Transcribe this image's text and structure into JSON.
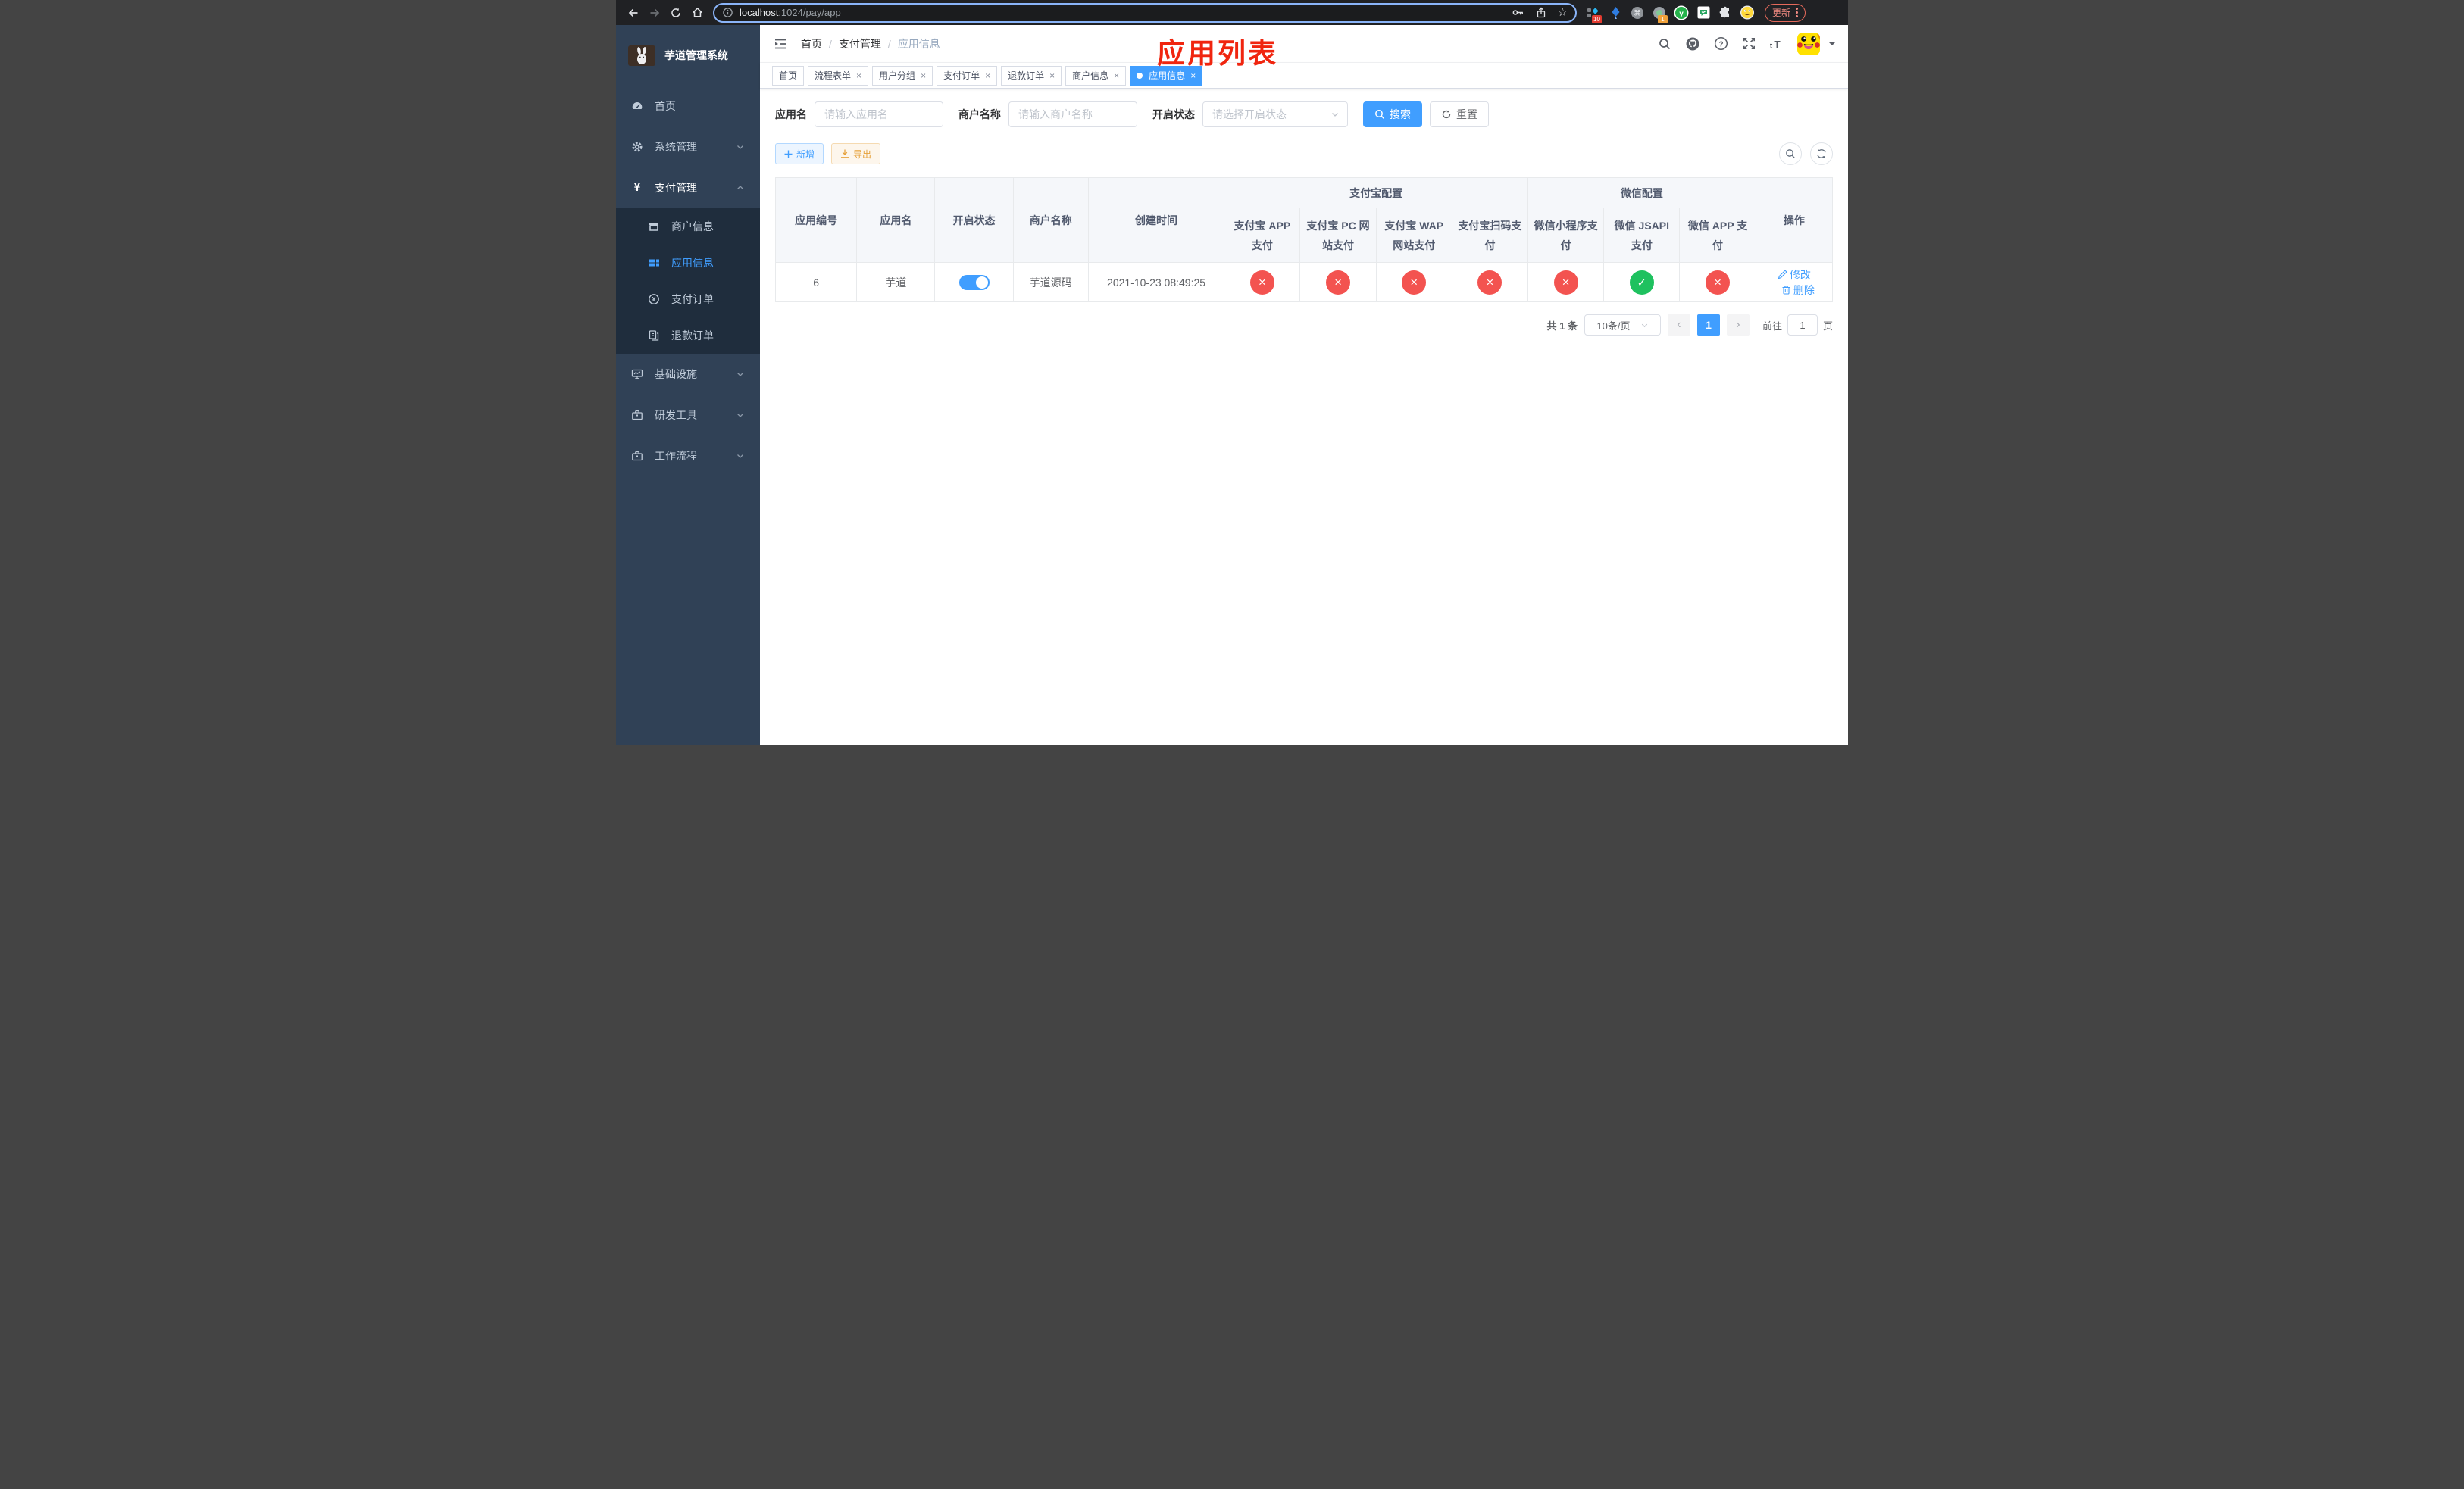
{
  "browser": {
    "url_host": "localhost",
    "url_path": ":1024/pay/app",
    "update_label": "更新",
    "ext_badge_blue_diamond": "10",
    "ext_badge_record": "1"
  },
  "annotation": {
    "text": "应用列表",
    "color": "#f0250f"
  },
  "colors": {
    "primary": "#409eff",
    "danger": "#f35350",
    "success": "#1ec15f",
    "warning": "#e6a23c",
    "sidebar_bg": "#304156",
    "submenu_bg": "#1f2d3d"
  },
  "sidebar": {
    "title": "芋道管理系统",
    "menu_top": [
      {
        "label": "首页",
        "icon": "dashboard-icon"
      },
      {
        "label": "系统管理",
        "icon": "gear-icon"
      },
      {
        "label": "支付管理",
        "icon": "yen-icon"
      }
    ],
    "pay_children": [
      {
        "label": "商户信息",
        "icon": "shop-icon"
      },
      {
        "label": "应用信息",
        "icon": "grid-icon"
      },
      {
        "label": "支付订单",
        "icon": "pay-order-icon"
      },
      {
        "label": "退款订单",
        "icon": "refund-icon"
      }
    ],
    "menu_bottom": [
      {
        "label": "基础设施",
        "icon": "monitor-icon"
      },
      {
        "label": "研发工具",
        "icon": "toolbox-icon"
      },
      {
        "label": "工作流程",
        "icon": "workflow-icon"
      }
    ]
  },
  "navbar": {
    "breadcrumb": [
      "首页",
      "支付管理",
      "应用信息"
    ]
  },
  "tabs": [
    {
      "label": "首页",
      "closable": false,
      "active": false
    },
    {
      "label": "流程表单",
      "closable": true,
      "active": false
    },
    {
      "label": "用户分组",
      "closable": true,
      "active": false
    },
    {
      "label": "支付订单",
      "closable": true,
      "active": false
    },
    {
      "label": "退款订单",
      "closable": true,
      "active": false
    },
    {
      "label": "商户信息",
      "closable": true,
      "active": false
    },
    {
      "label": "应用信息",
      "closable": true,
      "active": true
    }
  ],
  "filters": {
    "app_name_label": "应用名",
    "app_name_placeholder": "请输入应用名",
    "merchant_label": "商户名称",
    "merchant_placeholder": "请输入商户名称",
    "status_label": "开启状态",
    "status_placeholder": "请选择开启状态",
    "search_label": "搜索",
    "reset_label": "重置"
  },
  "toolbar": {
    "add_label": "新增",
    "export_label": "导出"
  },
  "table": {
    "columns": {
      "id": "应用编号",
      "name": "应用名",
      "status": "开启状态",
      "merchant": "商户名称",
      "created": "创建时间",
      "ops": "操作"
    },
    "groups": {
      "alipay": "支付宝配置",
      "wechat": "微信配置"
    },
    "channel_columns": [
      "支付宝 APP 支付",
      "支付宝 PC 网站支付",
      "支付宝 WAP 网站支付",
      "支付宝扫码支付",
      "微信小程序支付",
      "微信 JSAPI 支付",
      "微信 APP 支付"
    ],
    "row": {
      "id": "6",
      "name": "芋道",
      "enabled": "on",
      "merchant": "芋道源码",
      "created": "2021-10-23 08:49:25",
      "channels": [
        "cross",
        "cross",
        "cross",
        "cross",
        "cross",
        "check",
        "cross"
      ],
      "edit_label": "修改",
      "delete_label": "删除"
    }
  },
  "pagination": {
    "total": "共 1 条",
    "page_size": "10条/页",
    "page": "1",
    "goto_prefix": "前往",
    "goto_value": "1",
    "goto_suffix": "页"
  }
}
